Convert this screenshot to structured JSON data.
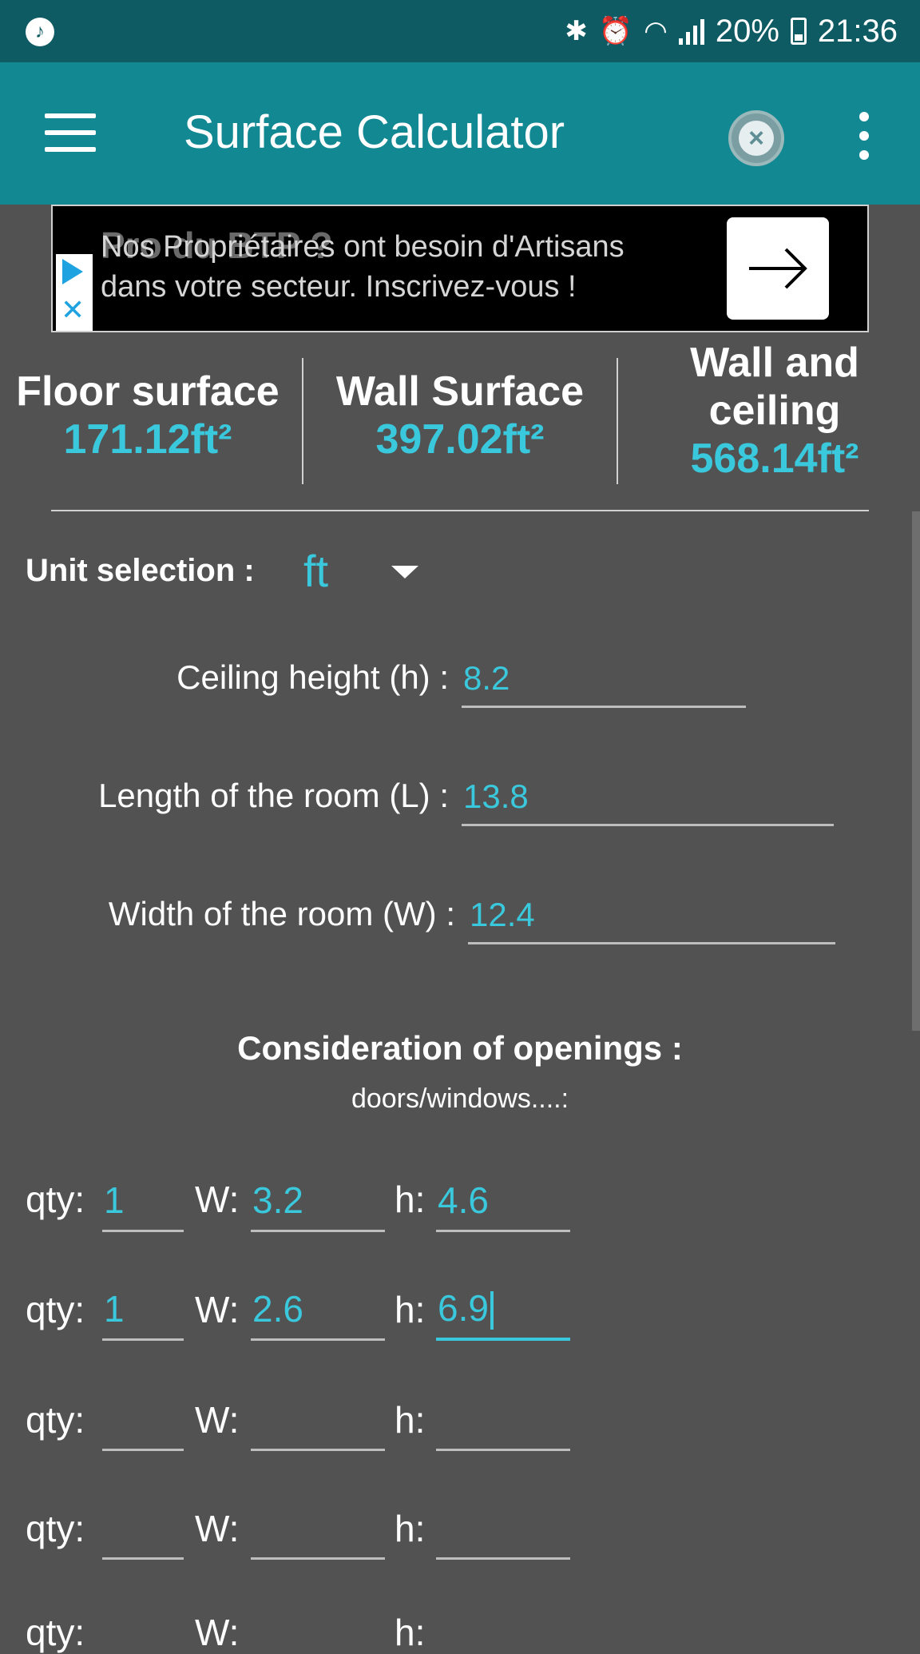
{
  "status_bar": {
    "time": "21:36",
    "battery": "20%",
    "icons": [
      "music-icon",
      "bluetooth-icon",
      "alarm-icon",
      "wifi-icon",
      "signal-icon",
      "battery-icon"
    ]
  },
  "app_bar": {
    "title": "Surface Calculator"
  },
  "ad": {
    "title": "Pro du BTP ?",
    "line1": "Nos Propriétaires ont besoin d'Artisans",
    "line2": "dans votre secteur. Inscrivez-vous !"
  },
  "summary": {
    "floor": {
      "label": "Floor surface",
      "value": "171.12ft²"
    },
    "wall": {
      "label": "Wall Surface",
      "value": "397.02ft²"
    },
    "wall_ceiling": {
      "label_line1": "Wall and",
      "label_line2": "ceiling",
      "value": "568.14ft²"
    }
  },
  "unit": {
    "label": "Unit selection :",
    "value": "ft"
  },
  "fields": {
    "ceiling_height": {
      "label": "Ceiling height (h) :",
      "value": "8.2"
    },
    "length": {
      "label": "Length of the room (L) :",
      "value": "13.8"
    },
    "width": {
      "label": "Width of the room (W) :",
      "value": "12.4"
    }
  },
  "openings": {
    "title": "Consideration of openings :",
    "subtitle": "doors/windows....:",
    "qty_label": "qty:",
    "w_label": "W:",
    "h_label": "h:",
    "rows": [
      {
        "qty": "1",
        "w": "3.2",
        "h": "4.6"
      },
      {
        "qty": "1",
        "w": "2.6",
        "h": "6.9"
      },
      {
        "qty": "",
        "w": "",
        "h": ""
      },
      {
        "qty": "",
        "w": "",
        "h": ""
      },
      {
        "qty": "",
        "w": "",
        "h": ""
      }
    ]
  },
  "colors": {
    "status_bar": "#0e5b63",
    "app_bar": "#128892",
    "background": "#525252",
    "accent": "#3ac8dd"
  }
}
